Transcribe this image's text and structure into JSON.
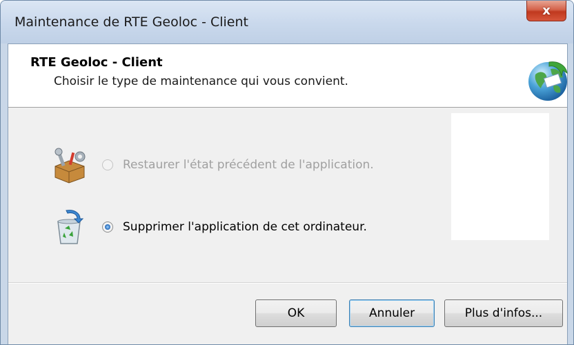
{
  "window": {
    "title": "Maintenance de RTE Geoloc - Client",
    "close_glyph": "x"
  },
  "header": {
    "title": "RTE Geoloc - Client",
    "subtitle": "Choisir le type de maintenance qui vous convient.",
    "icon": "globe-icon"
  },
  "options": [
    {
      "label": "Restaurer l'état précédent de l'application.",
      "icon": "repair-toolbox-icon",
      "selected": false,
      "enabled": false
    },
    {
      "label": "Supprimer l'application de cet ordinateur.",
      "icon": "recycle-bin-icon",
      "selected": true,
      "enabled": true
    }
  ],
  "buttons": {
    "ok": "OK",
    "cancel": "Annuler",
    "more_info": "Plus d'infos..."
  },
  "colors": {
    "titlebar": "#c9d8ec",
    "close_button": "#c0391f",
    "client_background": "#f0f0f0",
    "radio_checked": "#1f63b4"
  }
}
